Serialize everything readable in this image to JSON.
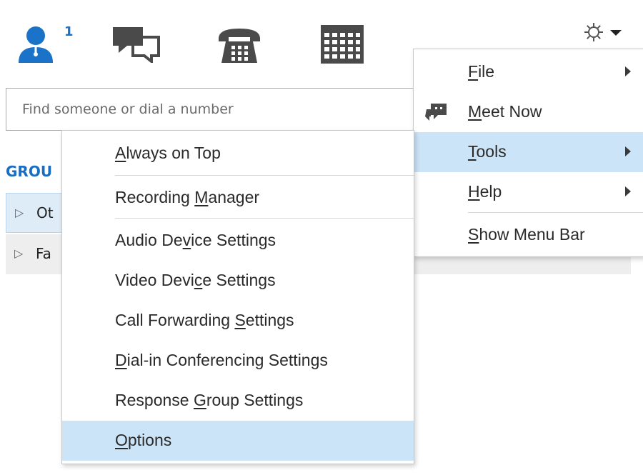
{
  "toolbar": {
    "contacts_count": "1",
    "icons": [
      "contacts-icon",
      "conversations-icon",
      "phone-icon",
      "meetings-icon",
      "gear-icon",
      "chevron-down-icon"
    ]
  },
  "search": {
    "placeholder": "Find someone or dial a number"
  },
  "groups": {
    "label": "GROU",
    "rows": [
      "Ot",
      "Fa"
    ]
  },
  "main_menu": {
    "items": [
      {
        "pre": "",
        "ul": "F",
        "post": "ile",
        "submenu": true
      },
      {
        "pre": "",
        "ul": "M",
        "post": "eet Now",
        "submenu": false
      },
      {
        "pre": "",
        "ul": "T",
        "post": "ools",
        "submenu": true
      },
      {
        "pre": "",
        "ul": "H",
        "post": "elp",
        "submenu": true
      },
      {
        "pre": "",
        "ul": "S",
        "post": "how Menu Bar",
        "submenu": false
      }
    ]
  },
  "tools_menu": {
    "items": [
      {
        "pre": "",
        "ul": "A",
        "post": "lways on Top"
      },
      {
        "pre": "Recording ",
        "ul": "M",
        "post": "anager"
      },
      {
        "pre": "Audio De",
        "ul": "v",
        "post": "ice Settings"
      },
      {
        "pre": "Video Devi",
        "ul": "c",
        "post": "e Settings"
      },
      {
        "pre": "Call Forwarding ",
        "ul": "S",
        "post": "ettings"
      },
      {
        "pre": "",
        "ul": "D",
        "post": "ial-in Conferencing Settings"
      },
      {
        "pre": "Response ",
        "ul": "G",
        "post": "roup Settings"
      },
      {
        "pre": "",
        "ul": "O",
        "post": "ptions"
      }
    ]
  },
  "colors": {
    "accent": "#1a73c8",
    "highlight": "#cce4f7",
    "group_blue": "#1a6ec2"
  }
}
